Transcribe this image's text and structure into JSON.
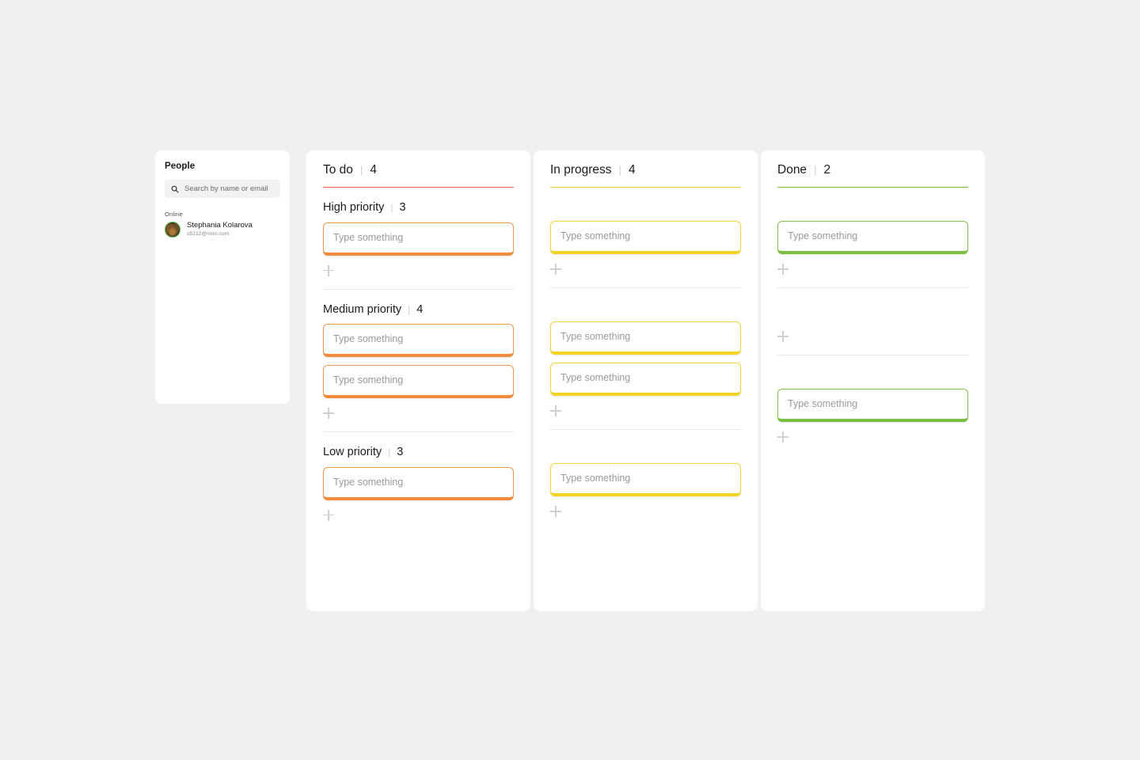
{
  "people": {
    "title": "People",
    "search": {
      "placeholder": "Search by name or email",
      "icon": "search-icon"
    },
    "online_label": "Online",
    "members": [
      {
        "name": "Stephania Kolarova",
        "email": "s5212@miro.com",
        "status": "online",
        "status_ring_color": "#4fc14f"
      }
    ]
  },
  "board": {
    "card_placeholder": "Type something",
    "add_icon": "plus-icon",
    "separator": "|",
    "columns": [
      {
        "title": "To do",
        "count": "4",
        "accent": "#e8603c",
        "card_color": "orange",
        "sections": [
          {
            "title": "High priority",
            "count": "3",
            "cards": 1
          },
          {
            "title": "Medium priority",
            "count": "4",
            "cards": 2
          },
          {
            "title": "Low priority",
            "count": "3",
            "cards": 1
          }
        ]
      },
      {
        "title": "In progress",
        "count": "4",
        "accent": "#f2cb30",
        "card_color": "yellow",
        "sections": [
          {
            "title": "",
            "count": "",
            "cards": 1
          },
          {
            "title": "",
            "count": "",
            "cards": 2
          },
          {
            "title": "",
            "count": "",
            "cards": 1
          }
        ]
      },
      {
        "title": "Done",
        "count": "2",
        "accent": "#79bf40",
        "card_color": "green",
        "sections": [
          {
            "title": "",
            "count": "",
            "cards": 1
          },
          {
            "title": "",
            "count": "",
            "cards": 0
          },
          {
            "title": "",
            "count": "",
            "cards": 1
          }
        ]
      }
    ]
  }
}
